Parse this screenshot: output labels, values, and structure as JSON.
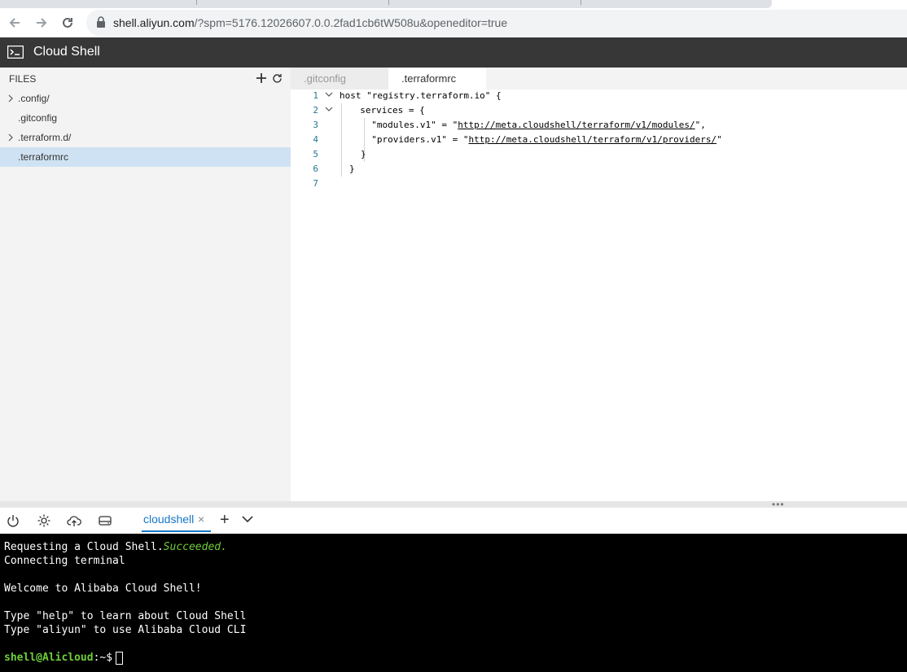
{
  "browser": {
    "url_host": "shell.aliyun.com",
    "url_path": "/?spm=5176.12026607.0.0.2fad1cb6tW508u&openeditor=true"
  },
  "app": {
    "title": "Cloud Shell"
  },
  "explorer": {
    "header": "FILES",
    "items": [
      {
        "name": ".config/",
        "type": "folder"
      },
      {
        "name": ".gitconfig",
        "type": "file"
      },
      {
        "name": ".terraform.d/",
        "type": "folder"
      },
      {
        "name": ".terraformrc",
        "type": "file",
        "selected": true
      }
    ]
  },
  "editor": {
    "tabs": [
      {
        "label": ".gitconfig",
        "active": false
      },
      {
        "label": ".terraformrc",
        "active": true
      }
    ],
    "line_numbers": [
      "1",
      "2",
      "3",
      "4",
      "5",
      "6",
      "7"
    ],
    "lines": {
      "l1": "host \"registry.terraform.io\" {",
      "l2": "  services = {",
      "l3_prefix": "  \"modules.v1\" = \"",
      "l3_link": "http://meta.cloudshell/terraform/v1/modules/",
      "l3_suffix": "\",",
      "l4_prefix": "  \"providers.v1\" = \"",
      "l4_link": "http://meta.cloudshell/terraform/v1/providers/",
      "l4_suffix": "\"",
      "l5": "}",
      "l6": "}"
    }
  },
  "terminal_toolbar": {
    "tab_label": "cloudshell",
    "tab_close": "×",
    "add": "+"
  },
  "terminal": {
    "line1_prefix": "Requesting a Cloud Shell.",
    "line1_status": "Succeeded.",
    "line2": "Connecting terminal",
    "line3": "Welcome to Alibaba Cloud Shell!",
    "line4": "Type \"help\" to learn about Cloud Shell",
    "line5": "Type \"aliyun\" to use Alibaba Cloud CLI",
    "prompt_user": "shell@Alicloud",
    "prompt_rest": ":~$"
  },
  "colors": {
    "accent": "#1677c9",
    "header_bg": "#373737",
    "terminal_bg": "#000000",
    "terminal_success": "#6fcf3a"
  }
}
